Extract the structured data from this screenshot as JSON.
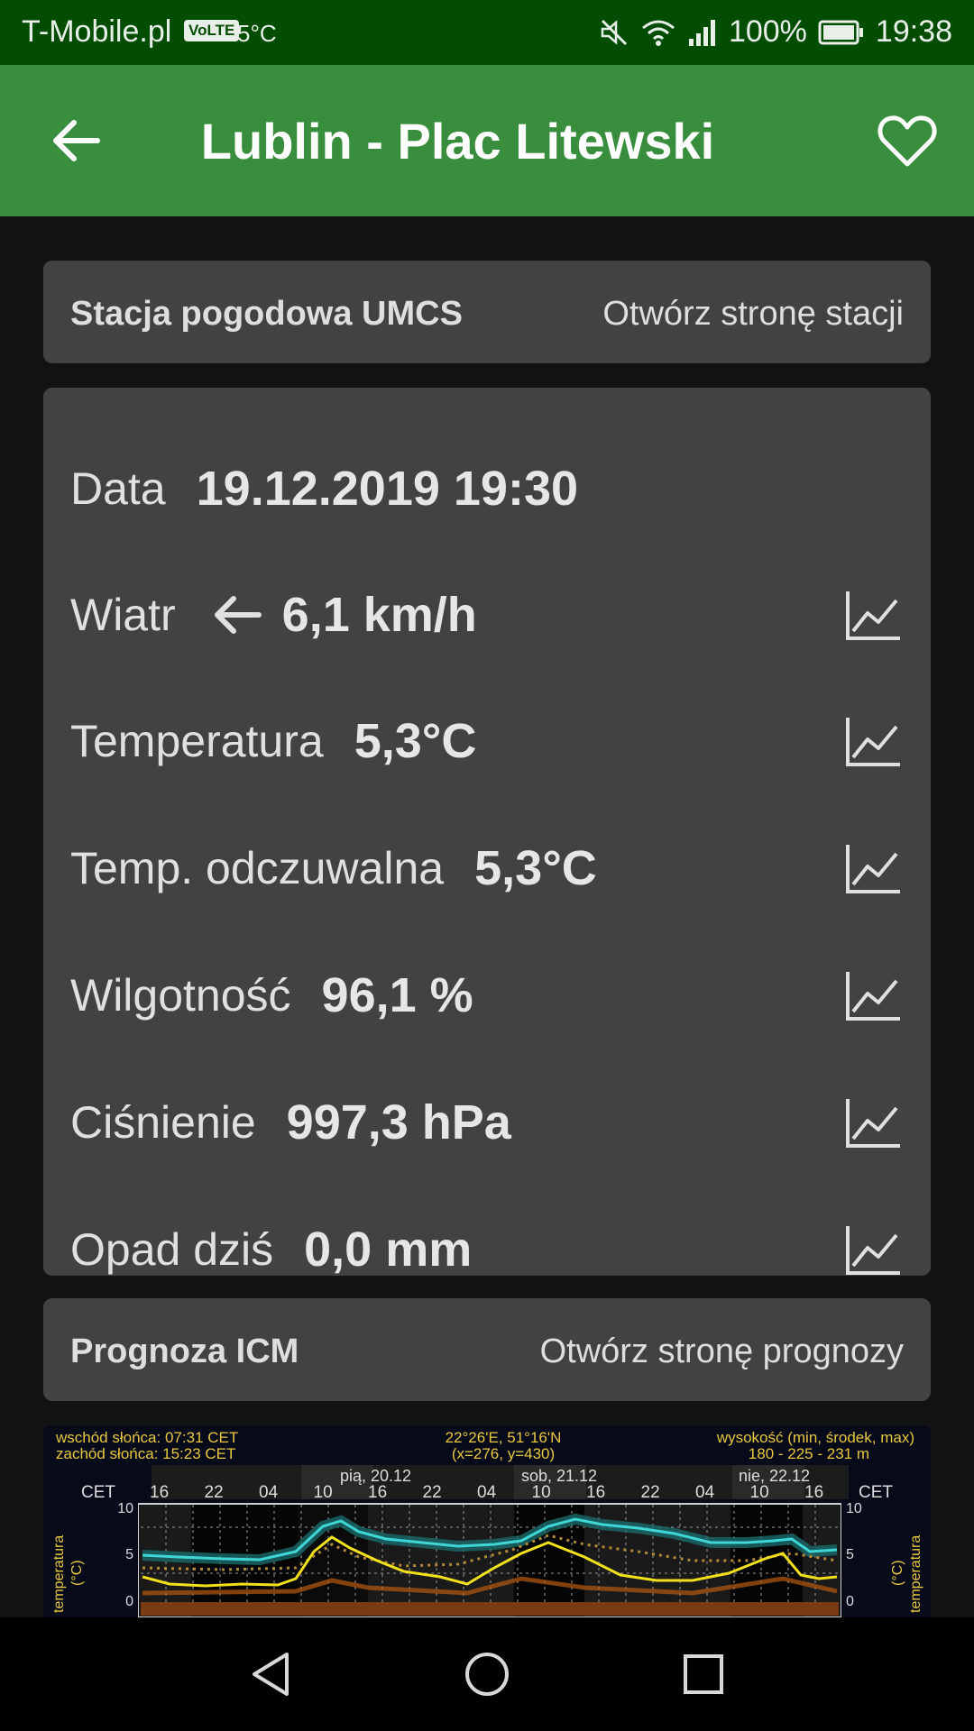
{
  "status_bar": {
    "carrier": "T-Mobile.pl",
    "volte": "VoLTE",
    "temperature": "5°C",
    "battery": "100%",
    "time": "19:38"
  },
  "app_bar": {
    "title": "Lublin - Plac Litewski"
  },
  "station": {
    "name": "Stacja pogodowa UMCS",
    "link": "Otwórz stronę stacji"
  },
  "readings": {
    "date_label": "Data",
    "date_value": "19.12.2019 19:30",
    "wind_label": "Wiatr",
    "wind_value": "6,1 km/h",
    "temperature_label": "Temperatura",
    "temperature_value": "5,3°C",
    "feels_label": "Temp. odczuwalna",
    "feels_value": "5,3°C",
    "humidity_label": "Wilgotność",
    "humidity_value": "96,1 %",
    "pressure_label": "Ciśnienie",
    "pressure_value": "997,3 hPa",
    "rain_label": "Opad dziś",
    "rain_value": "0,0 mm"
  },
  "forecast": {
    "name": "Prognoza ICM",
    "link": "Otwórz stronę prognozy",
    "meteogram": {
      "sunrise": "wschód słońca: 07:31 CET",
      "sunset": "zachód słońca: 15:23 CET",
      "coords": "22°26'E, 51°16'N",
      "grid": "(x=276,  y=430)",
      "altitude_label": "wysokość (min, środek, max)",
      "altitude_values": "180 - 225 - 231 m",
      "tz": "CET",
      "hours": [
        "16",
        "22",
        "04",
        "10",
        "16",
        "22",
        "04",
        "10",
        "16",
        "22",
        "04",
        "10",
        "16"
      ],
      "days": [
        "pią, 20.12",
        "sob, 21.12",
        "nie, 22.12"
      ],
      "y_axis_label": "temperatura",
      "y_axis_unit": "(°C)",
      "y_ticks": [
        "10",
        "5",
        "0"
      ],
      "colors": {
        "max": "#3fd6d6",
        "min": "#f2e01c",
        "dew": "#b08a3a"
      }
    }
  },
  "colors": {
    "status_bar": "#024d02",
    "app_bar": "#388e3c",
    "background": "#121212",
    "card": "#424242"
  }
}
